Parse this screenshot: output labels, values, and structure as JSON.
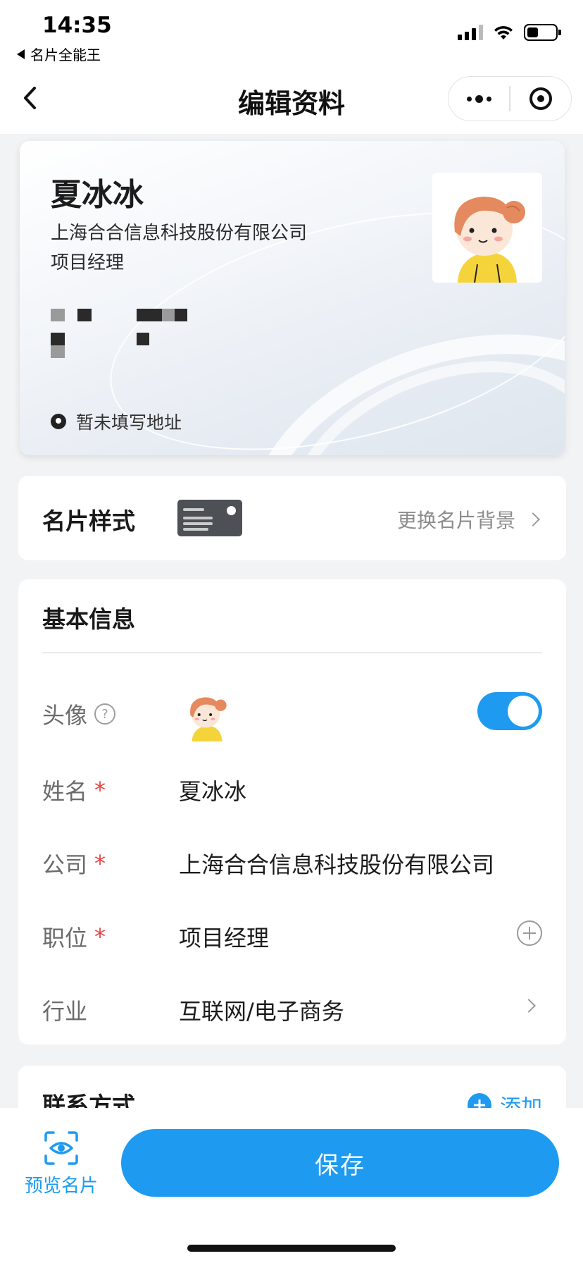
{
  "status_bar": {
    "time": "14:35",
    "back_app": "名片全能王"
  },
  "nav": {
    "title": "编辑资料"
  },
  "card": {
    "name": "夏冰冰",
    "company": "上海合合信息科技股份有限公司",
    "title": "项目经理",
    "address": "暂未填写地址"
  },
  "card_style": {
    "label": "名片样式",
    "action": "更换名片背景"
  },
  "basic_info": {
    "title": "基本信息",
    "avatar_label": "头像",
    "avatar_help": "?",
    "avatar_enabled": true,
    "required_mark": "*",
    "name_label": "姓名",
    "name_value": "夏冰冰",
    "company_label": "公司",
    "company_value": "上海合合信息科技股份有限公司",
    "position_label": "职位",
    "position_value": "项目经理",
    "industry_label": "行业",
    "industry_value": "互联网/电子商务"
  },
  "contact": {
    "title": "联系方式",
    "add_label": "添加"
  },
  "bottom": {
    "preview_label": "预览名片",
    "save_label": "保存"
  },
  "colors": {
    "accent": "#1e9bf0",
    "required": "#e54545",
    "page_bg": "#f2f3f5"
  }
}
